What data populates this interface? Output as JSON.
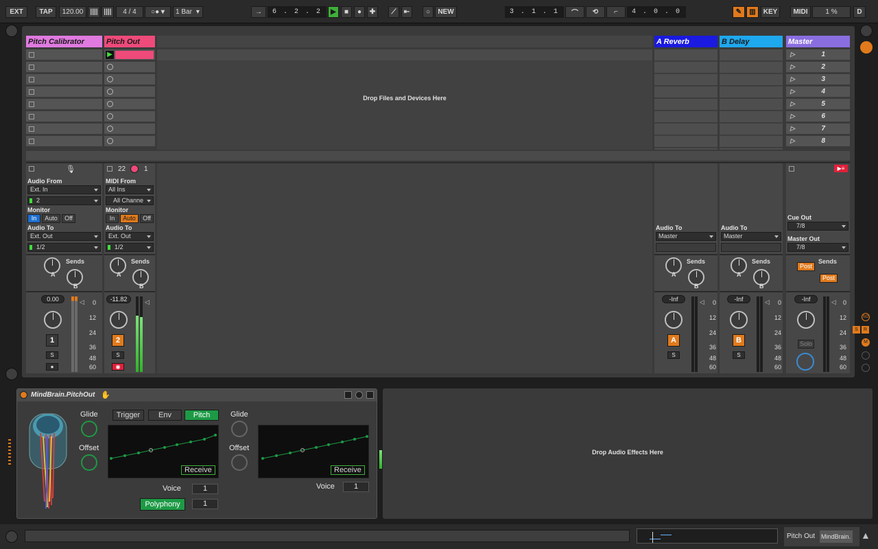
{
  "transport": {
    "ext": "EXT",
    "tap": "TAP",
    "tempo": "120.00",
    "signature": "4 / 4",
    "quantize": "1 Bar",
    "position": "6 . 2 . 2",
    "new": "NEW",
    "loop_start": "3 . 1 . 1",
    "loop_length": "4 . 0 . 0",
    "key": "KEY",
    "midi": "MIDI",
    "cpu": "1 %",
    "disk": "D"
  },
  "tracks": {
    "pitch_calibrator": {
      "name": "Pitch Calibrator",
      "color": "#e07ae0",
      "audio_from_label": "Audio From",
      "audio_from": "Ext. In",
      "input_channel": "2",
      "monitor_label": "Monitor",
      "monitor_in": "In",
      "monitor_auto": "Auto",
      "monitor_off": "Off",
      "audio_to_label": "Audio To",
      "audio_to": "Ext. Out",
      "output_channel": "1/2",
      "sends_label": "Sends",
      "send_a": "A",
      "send_b": "B",
      "volume": "0.00",
      "number": "1",
      "solo": "S"
    },
    "pitch_out": {
      "name": "Pitch Out",
      "color": "#ee4a7a",
      "midi_from_label": "MIDI From",
      "midi_from": "All Ins",
      "midi_channel": "All Channe",
      "pgm_left": "22",
      "pgm_right": "1",
      "monitor_label": "Monitor",
      "monitor_in": "In",
      "monitor_auto": "Auto",
      "monitor_off": "Off",
      "audio_to_label": "Audio To",
      "audio_to": "Ext. Out",
      "output_channel": "1/2",
      "sends_label": "Sends",
      "send_a": "A",
      "send_b": "B",
      "volume": "-11.82",
      "number": "2",
      "solo": "S"
    },
    "a_reverb": {
      "name": "A Reverb",
      "color": "#1a1ae0",
      "audio_to_label": "Audio To",
      "audio_to": "Master",
      "sends_label": "Sends",
      "send_a": "A",
      "send_b": "B",
      "volume": "-Inf",
      "letter": "A",
      "solo": "S"
    },
    "b_delay": {
      "name": "B Delay",
      "color": "#1ea8ee",
      "audio_to_label": "Audio To",
      "audio_to": "Master",
      "sends_label": "Sends",
      "send_a": "A",
      "send_b": "B",
      "volume": "-Inf",
      "letter": "B",
      "solo": "S"
    },
    "master": {
      "name": "Master",
      "color": "#8a6ee0",
      "cue_out_label": "Cue Out",
      "cue_out": "7/8",
      "master_out_label": "Master Out",
      "master_out": "7/8",
      "sends_label": "Sends",
      "post1": "Post",
      "post2": "Post",
      "volume": "-Inf",
      "solo_label": "Solo"
    }
  },
  "scenes": [
    "1",
    "2",
    "3",
    "4",
    "5",
    "6",
    "7",
    "8"
  ],
  "drop_files_text": "Drop Files and Devices Here",
  "meter_ticks": [
    "0",
    "12",
    "24",
    "36",
    "48",
    "60"
  ],
  "right_strip": {
    "so": "SO",
    "s": "S",
    "r": "R",
    "m": "M"
  },
  "device": {
    "title": "MindBrain.PitchOut",
    "glide_label": "Glide",
    "offset_label": "Offset",
    "tab_trigger": "Trigger",
    "tab_env": "Env",
    "tab_pitch": "Pitch",
    "receive_label": "Receive",
    "voice_label": "Voice",
    "voice_value": "1",
    "voice_value2": "1",
    "polyphony_label": "Polyphony",
    "polyphony_value": "1",
    "accent": "#1d9a45"
  },
  "drop_effects_text": "Drop Audio Effects Here",
  "status": {
    "track_name": "Pitch Out",
    "device_name": "MindBrain."
  }
}
